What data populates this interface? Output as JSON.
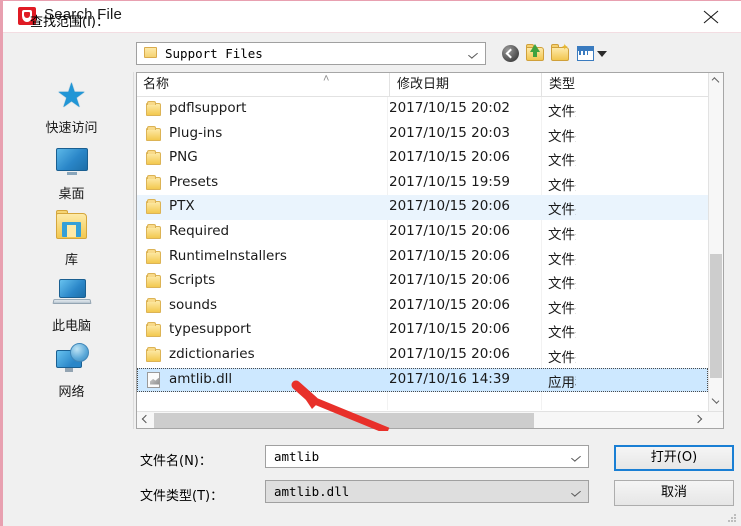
{
  "window": {
    "title": "Search File",
    "app_icon": "shield-icon",
    "close_label": "✕",
    "accent_red": "#e01b24",
    "focus_blue": "#1a7fd4"
  },
  "toolbar": {
    "lookin_label_prefix": "查找范围(",
    "lookin_label_accel": "I",
    "lookin_label_suffix": ")：",
    "lookin_label_full": "查找范围(I)：",
    "path_value": "Support Files",
    "path_icon": "folder-icon",
    "buttons": [
      {
        "name": "back-button",
        "tooltip": "返回"
      },
      {
        "name": "up-one-level-button",
        "tooltip": "向上一级"
      },
      {
        "name": "new-folder-button",
        "tooltip": "新建文件夹"
      },
      {
        "name": "views-button",
        "tooltip": "视图"
      }
    ]
  },
  "places": [
    {
      "label": "快速访问",
      "icon": "star-icon"
    },
    {
      "label": "桌面",
      "icon": "monitor-icon"
    },
    {
      "label": "库",
      "icon": "library-folder-icon"
    },
    {
      "label": "此电脑",
      "icon": "laptop-icon"
    },
    {
      "label": "网络",
      "icon": "network-icon"
    }
  ],
  "list": {
    "columns": [
      {
        "key": "name",
        "label": "名称"
      },
      {
        "key": "date",
        "label": "修改日期"
      },
      {
        "key": "type",
        "label": "类型"
      }
    ],
    "sort_indicator": "˄",
    "rows": [
      {
        "name": "pdflsupport",
        "date": "2017/10/15 20:02",
        "type": "文件夹",
        "icon": "folder-icon",
        "state": "normal"
      },
      {
        "name": "Plug-ins",
        "date": "2017/10/15 20:03",
        "type": "文件夹",
        "icon": "folder-icon",
        "state": "normal"
      },
      {
        "name": "PNG",
        "date": "2017/10/15 20:06",
        "type": "文件夹",
        "icon": "folder-icon",
        "state": "normal"
      },
      {
        "name": "Presets",
        "date": "2017/10/15 19:59",
        "type": "文件夹",
        "icon": "folder-icon",
        "state": "normal"
      },
      {
        "name": "PTX",
        "date": "2017/10/15 20:06",
        "type": "文件夹",
        "icon": "folder-icon",
        "state": "hover"
      },
      {
        "name": "Required",
        "date": "2017/10/15 20:06",
        "type": "文件夹",
        "icon": "folder-icon",
        "state": "normal"
      },
      {
        "name": "RuntimeInstallers",
        "date": "2017/10/15 20:06",
        "type": "文件夹",
        "icon": "folder-icon",
        "state": "normal"
      },
      {
        "name": "Scripts",
        "date": "2017/10/15 20:06",
        "type": "文件夹",
        "icon": "folder-icon",
        "state": "normal"
      },
      {
        "name": "sounds",
        "date": "2017/10/15 20:06",
        "type": "文件夹",
        "icon": "folder-icon",
        "state": "normal"
      },
      {
        "name": "typesupport",
        "date": "2017/10/15 20:06",
        "type": "文件夹",
        "icon": "folder-icon",
        "state": "normal"
      },
      {
        "name": "zdictionaries",
        "date": "2017/10/15 20:06",
        "type": "文件夹",
        "icon": "folder-icon",
        "state": "normal"
      },
      {
        "name": "amtlib.dll",
        "date": "2017/10/16 14:39",
        "type": "应用程序扩展",
        "icon": "dll-file-icon",
        "state": "selected"
      }
    ]
  },
  "form": {
    "filename_label": "文件名(N)：",
    "filename_value": "amtlib",
    "filetype_label": "文件类型(T)：",
    "filetype_value": "amtlib.dll",
    "open_button": "打开(O)",
    "cancel_button": "取消"
  },
  "annotation": {
    "arrow_color": "#e8302a",
    "points_to": "amtlib.dll"
  }
}
